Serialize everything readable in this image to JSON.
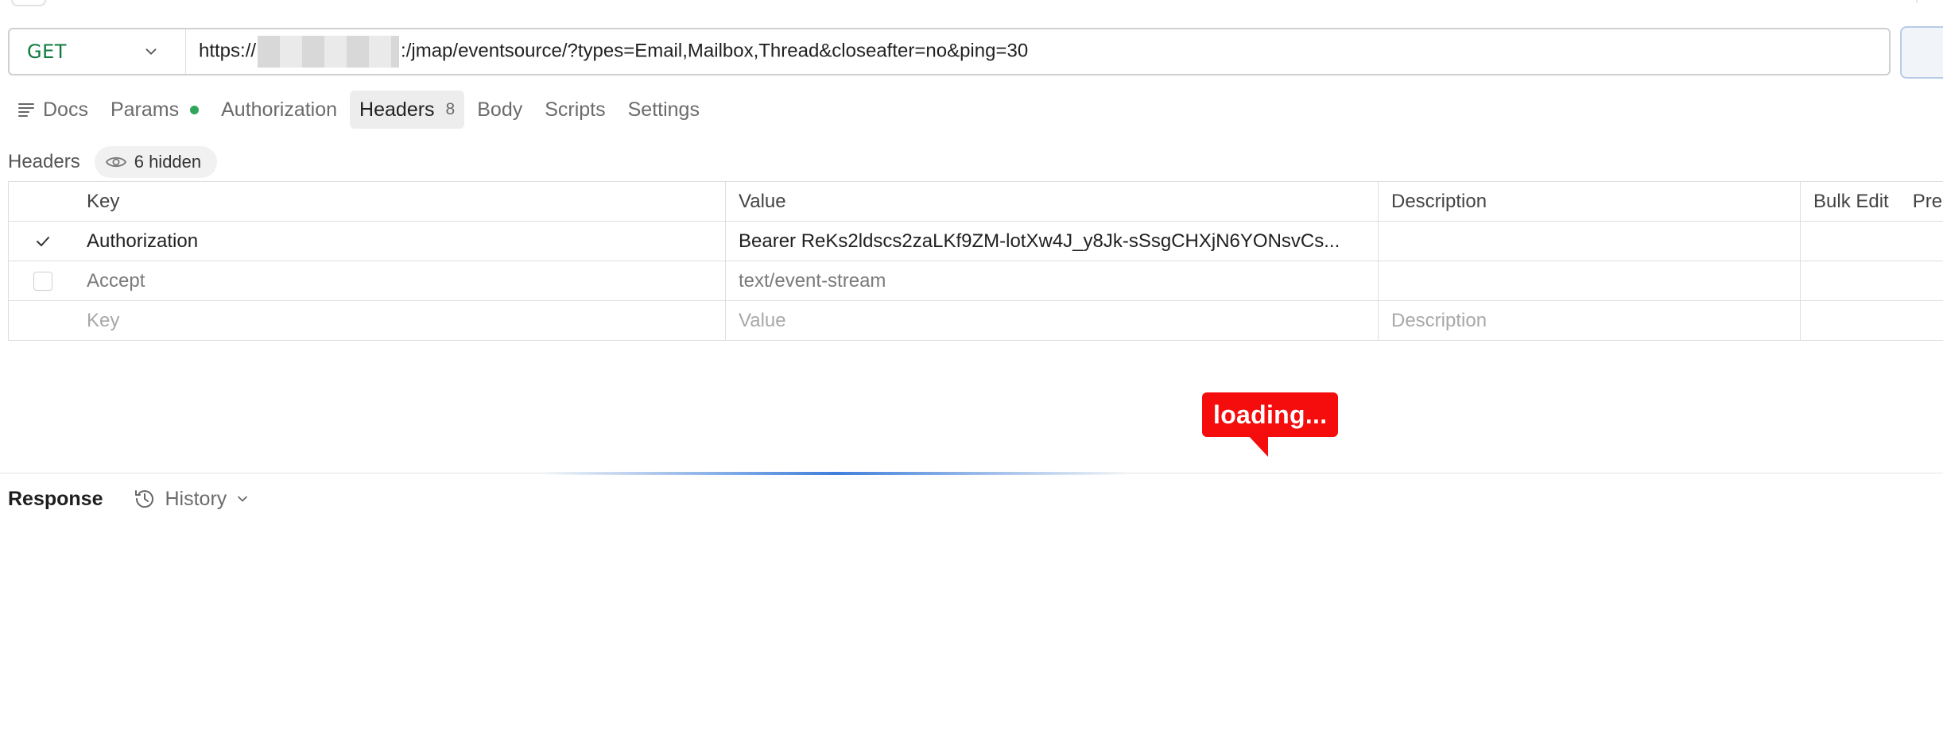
{
  "request": {
    "method": "GET",
    "url_prefix": "https://",
    "url_suffix": ":/jmap/eventsource/?types=Email,Mailbox,Thread&closeafter=no&ping=30"
  },
  "tabs": [
    {
      "label": "Docs"
    },
    {
      "label": "Params"
    },
    {
      "label": "Authorization"
    },
    {
      "label": "Headers",
      "count": "8"
    },
    {
      "label": "Body"
    },
    {
      "label": "Scripts"
    },
    {
      "label": "Settings"
    }
  ],
  "headers_section": {
    "title": "Headers",
    "hidden_label": "6 hidden"
  },
  "table": {
    "columns": {
      "key": "Key",
      "value": "Value",
      "description": "Description",
      "bulk_edit": "Bulk Edit",
      "presets": "Pre"
    },
    "rows": [
      {
        "checked": true,
        "key": "Authorization",
        "value": "Bearer ReKs2ldscs2zaLKf9ZM-lotXw4J_y8Jk-sSsgCHXjN6YONsvCs...",
        "description": ""
      },
      {
        "checked": false,
        "key": "Accept",
        "value": "text/event-stream",
        "description": ""
      }
    ],
    "placeholder": {
      "key": "Key",
      "value": "Value",
      "description": "Description"
    }
  },
  "loading_label": "loading...",
  "response": {
    "title": "Response",
    "history_label": "History"
  },
  "colors": {
    "method_green": "#0f7b3f",
    "status_dot": "#2fa65a",
    "loading_red": "#f50d0d",
    "progress_blue": "#3f7fdc"
  }
}
